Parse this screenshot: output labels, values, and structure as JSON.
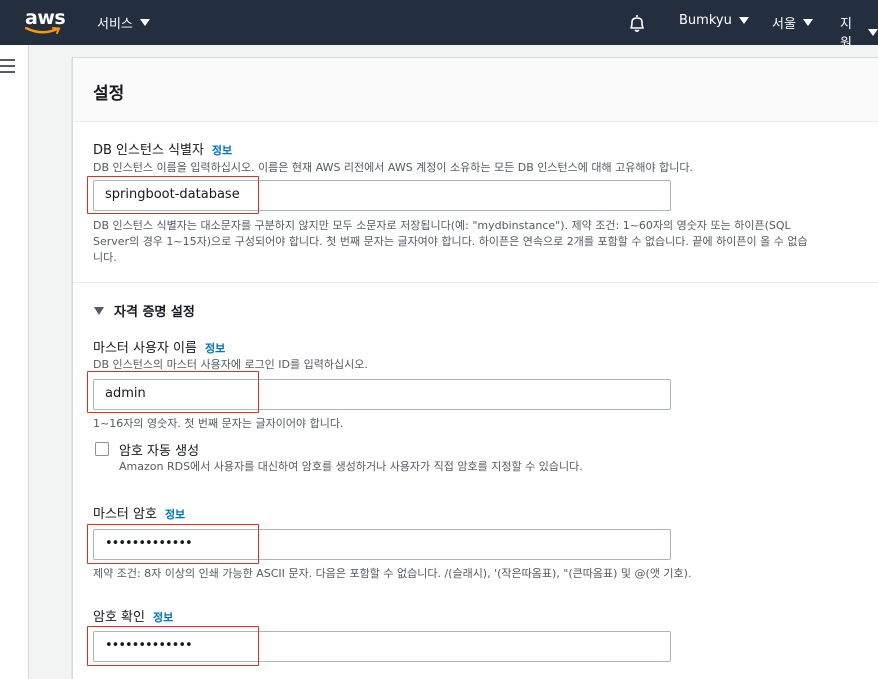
{
  "nav": {
    "logo_text": "aws",
    "services_label": "서비스",
    "user_label": "Bumkyu",
    "region_label": "서울",
    "support_label": "지원"
  },
  "settings": {
    "title": "설정",
    "identifier": {
      "label": "DB 인스턴스 식별자",
      "info": "정보",
      "description": "DB 인스턴스 이름을 입력하십시오. 이름은 현재 AWS 리전에서 AWS 계정이 소유하는 모든 DB 인스턴스에 대해 고유해야 합니다.",
      "value": "springboot-database",
      "constraint_line1": "DB 인스턴스 식별자는 대소문자를 구분하지 않지만 모두 소문자로 저장됩니다(예: \"mydbinstance\"). 제약 조건: 1~60자의 영숫자 또는 하이픈(SQL",
      "constraint_line2": "Server의 경우 1~15자)으로 구성되어야 합니다. 첫 번째 문자는 글자여야 합니다. 하이픈은 연속으로 2개를 포함할 수 없습니다. 끝에 하이픈이 올 수 없습",
      "constraint_line3": "니다."
    },
    "credentials": {
      "section_title": "자격 증명 설정",
      "master_user": {
        "label": "마스터 사용자 이름",
        "info": "정보",
        "description": "DB 인스턴스의 마스터 사용자에 로그인 ID를 입력하십시오.",
        "value": "admin",
        "constraint": "1~16자의 영숫자. 첫 번째 문자는 글자이어야 합니다."
      },
      "auto_generate": {
        "label": "암호 자동 생성",
        "description": "Amazon RDS에서 사용자를 대신하여 암호를 생성하거나 사용자가 직접 암호를 지정할 수 있습니다.",
        "checked": false
      },
      "master_password": {
        "label": "마스터 암호",
        "info": "정보",
        "value": "•••••••••••••",
        "constraint": "제약 조건: 8자 이상의 인쇄 가능한 ASCII 문자. 다음은 포함할 수 없습니다. /(슬래시), '(작은따옴표), \"(큰따옴표) 및 @(앳 기호)."
      },
      "confirm_password": {
        "label": "암호 확인",
        "info": "정보",
        "value": "•••••••••••••"
      }
    }
  },
  "colors": {
    "nav_bg": "#232f3e",
    "info_link": "#0073bb",
    "highlight": "#e0301e",
    "aws_smile": "#ff9900"
  }
}
